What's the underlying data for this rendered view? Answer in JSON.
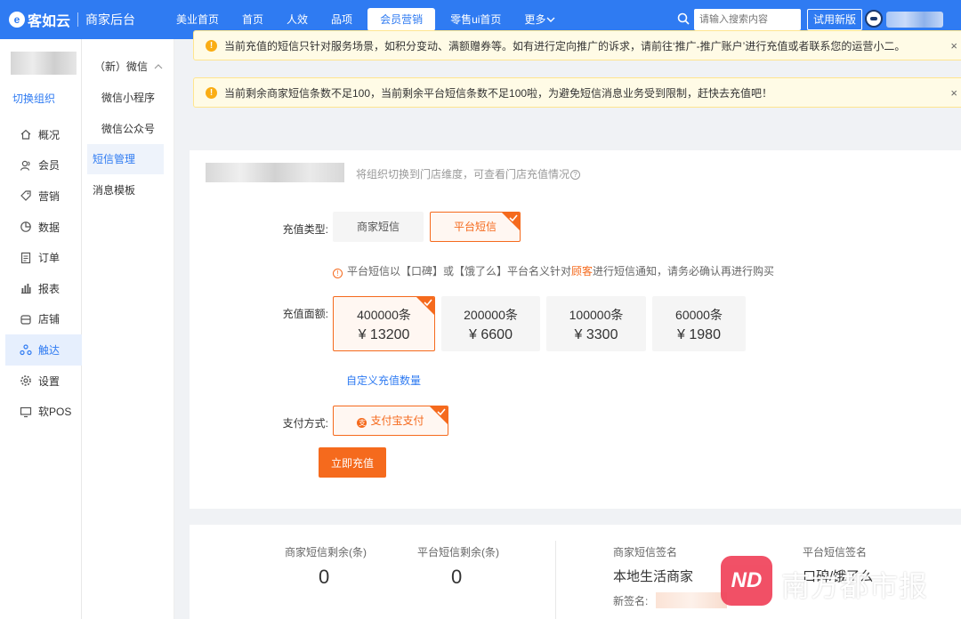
{
  "brand": {
    "logo_mark": "e",
    "logo_text": "客如云",
    "subtitle": "商家后台"
  },
  "nav": {
    "items": [
      "美业首页",
      "首页",
      "人效",
      "品项",
      "会员营销",
      "零售ui首页",
      "更多"
    ],
    "active_index": 4
  },
  "search": {
    "placeholder": "请输入搜索内容"
  },
  "trial_button": "试用新版",
  "sidebar": {
    "switch_org": "切换组织",
    "items": [
      {
        "label": "概况",
        "icon": "home-icon"
      },
      {
        "label": "会员",
        "icon": "user-icon"
      },
      {
        "label": "营销",
        "icon": "tag-icon"
      },
      {
        "label": "数据",
        "icon": "pie-icon"
      },
      {
        "label": "订单",
        "icon": "doc-icon"
      },
      {
        "label": "报表",
        "icon": "bar-chart-icon"
      },
      {
        "label": "店铺",
        "icon": "store-icon"
      },
      {
        "label": "触达",
        "icon": "reach-icon"
      },
      {
        "label": "设置",
        "icon": "gear-icon"
      },
      {
        "label": "软POS",
        "icon": "monitor-icon"
      }
    ],
    "active_index": 7
  },
  "submenu": {
    "group": "（新）微信",
    "items": [
      "微信小程序",
      "微信公众号",
      "短信管理",
      "消息模板"
    ],
    "active_index": 2
  },
  "alerts": [
    {
      "text": "当前充值的短信只针对服务场景，如积分变动、满额赠券等。如有进行定向推广的诉求，请前往‘推广-推广账户’进行充值或者联系您的运营小二。"
    },
    {
      "text": "当前剩余商家短信条数不足100，当前剩余平台短信条数不足100啦，为避免短信消息业务受到限制，赶快去充值吧！"
    }
  ],
  "store_hint": "将组织切换到门店维度，可查看门店充值情况",
  "form": {
    "type_label": "充值类型:",
    "types": [
      "商家短信",
      "平台短信"
    ],
    "type_selected": 1,
    "notice_prefix": "平台短信以【口碑】或【饿了么】平台名义针对",
    "notice_highlight": "顾客",
    "notice_suffix": "进行短信通知，请务必确认再进行购买",
    "amount_label": "充值面额:",
    "amounts": [
      {
        "qty": "400000条",
        "price": "¥ 13200"
      },
      {
        "qty": "200000条",
        "price": "¥ 6600"
      },
      {
        "qty": "100000条",
        "price": "¥ 3300"
      },
      {
        "qty": "60000条",
        "price": "¥ 1980"
      }
    ],
    "amount_selected": 0,
    "custom_link": "自定义充值数量",
    "pay_label": "支付方式:",
    "pay_method": "支付宝支付",
    "submit": "立即充值"
  },
  "stats": {
    "merchant_remaining_label": "商家短信剩余(条)",
    "merchant_remaining": "0",
    "platform_remaining_label": "平台短信剩余(条)",
    "platform_remaining": "0",
    "merchant_sig_label": "商家短信签名",
    "merchant_sig": "本地生活商家",
    "new_sig_label": "新签名:",
    "platform_sig_label": "平台短信签名",
    "platform_sig": "口碑/饿了么"
  },
  "watermark": {
    "badge": "ND",
    "text": "南方都市报"
  },
  "colors": {
    "primary": "#2f7bf2",
    "accent": "#f56a1d",
    "warning": "#faad14"
  }
}
